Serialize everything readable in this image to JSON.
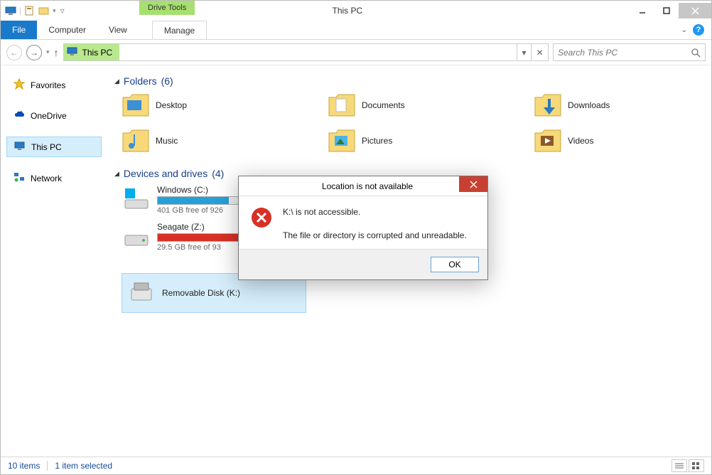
{
  "window": {
    "title": "This PC",
    "drive_tools_label": "Drive Tools"
  },
  "ribbon": {
    "file": "File",
    "computer": "Computer",
    "view": "View",
    "manage": "Manage"
  },
  "nav": {
    "breadcrumb": "This PC",
    "search_placeholder": "Search This PC"
  },
  "sidebar": {
    "favorites": "Favorites",
    "onedrive": "OneDrive",
    "thispc": "This PC",
    "network": "Network"
  },
  "groups": {
    "folders": {
      "label": "Folders",
      "count": "(6)"
    },
    "drives": {
      "label": "Devices and drives",
      "count": "(4)"
    }
  },
  "folders": {
    "desktop": "Desktop",
    "documents": "Documents",
    "downloads": "Downloads",
    "music": "Music",
    "pictures": "Pictures",
    "videos": "Videos"
  },
  "drives": {
    "c": {
      "name": "Windows (C:)",
      "free": "401 GB free of 926",
      "fill_pct": 56,
      "color": "#26a0da"
    },
    "z": {
      "name": "Seagate (Z:)",
      "free": "29.5 GB free of 93",
      "fill_pct": 97,
      "color": "#d93025"
    },
    "k": {
      "name": "Removable Disk (K:)"
    }
  },
  "dialog": {
    "title": "Location is not available",
    "line1": "K:\\ is not accessible.",
    "line2": "The file or directory is corrupted and unreadable.",
    "ok": "OK"
  },
  "statusbar": {
    "items": "10 items",
    "selected": "1 item selected"
  }
}
